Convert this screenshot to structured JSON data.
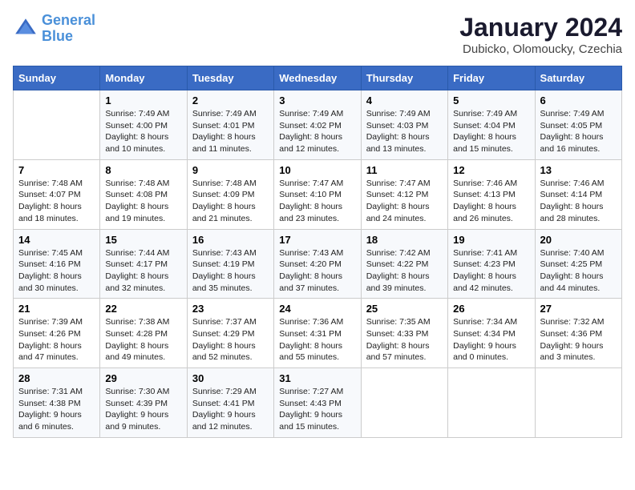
{
  "logo": {
    "line1": "General",
    "line2": "Blue"
  },
  "title": "January 2024",
  "subtitle": "Dubicko, Olomoucky, Czechia",
  "days_header": [
    "Sunday",
    "Monday",
    "Tuesday",
    "Wednesday",
    "Thursday",
    "Friday",
    "Saturday"
  ],
  "weeks": [
    [
      {
        "num": "",
        "info": ""
      },
      {
        "num": "1",
        "info": "Sunrise: 7:49 AM\nSunset: 4:00 PM\nDaylight: 8 hours\nand 10 minutes."
      },
      {
        "num": "2",
        "info": "Sunrise: 7:49 AM\nSunset: 4:01 PM\nDaylight: 8 hours\nand 11 minutes."
      },
      {
        "num": "3",
        "info": "Sunrise: 7:49 AM\nSunset: 4:02 PM\nDaylight: 8 hours\nand 12 minutes."
      },
      {
        "num": "4",
        "info": "Sunrise: 7:49 AM\nSunset: 4:03 PM\nDaylight: 8 hours\nand 13 minutes."
      },
      {
        "num": "5",
        "info": "Sunrise: 7:49 AM\nSunset: 4:04 PM\nDaylight: 8 hours\nand 15 minutes."
      },
      {
        "num": "6",
        "info": "Sunrise: 7:49 AM\nSunset: 4:05 PM\nDaylight: 8 hours\nand 16 minutes."
      }
    ],
    [
      {
        "num": "7",
        "info": "Sunrise: 7:48 AM\nSunset: 4:07 PM\nDaylight: 8 hours\nand 18 minutes."
      },
      {
        "num": "8",
        "info": "Sunrise: 7:48 AM\nSunset: 4:08 PM\nDaylight: 8 hours\nand 19 minutes."
      },
      {
        "num": "9",
        "info": "Sunrise: 7:48 AM\nSunset: 4:09 PM\nDaylight: 8 hours\nand 21 minutes."
      },
      {
        "num": "10",
        "info": "Sunrise: 7:47 AM\nSunset: 4:10 PM\nDaylight: 8 hours\nand 23 minutes."
      },
      {
        "num": "11",
        "info": "Sunrise: 7:47 AM\nSunset: 4:12 PM\nDaylight: 8 hours\nand 24 minutes."
      },
      {
        "num": "12",
        "info": "Sunrise: 7:46 AM\nSunset: 4:13 PM\nDaylight: 8 hours\nand 26 minutes."
      },
      {
        "num": "13",
        "info": "Sunrise: 7:46 AM\nSunset: 4:14 PM\nDaylight: 8 hours\nand 28 minutes."
      }
    ],
    [
      {
        "num": "14",
        "info": "Sunrise: 7:45 AM\nSunset: 4:16 PM\nDaylight: 8 hours\nand 30 minutes."
      },
      {
        "num": "15",
        "info": "Sunrise: 7:44 AM\nSunset: 4:17 PM\nDaylight: 8 hours\nand 32 minutes."
      },
      {
        "num": "16",
        "info": "Sunrise: 7:43 AM\nSunset: 4:19 PM\nDaylight: 8 hours\nand 35 minutes."
      },
      {
        "num": "17",
        "info": "Sunrise: 7:43 AM\nSunset: 4:20 PM\nDaylight: 8 hours\nand 37 minutes."
      },
      {
        "num": "18",
        "info": "Sunrise: 7:42 AM\nSunset: 4:22 PM\nDaylight: 8 hours\nand 39 minutes."
      },
      {
        "num": "19",
        "info": "Sunrise: 7:41 AM\nSunset: 4:23 PM\nDaylight: 8 hours\nand 42 minutes."
      },
      {
        "num": "20",
        "info": "Sunrise: 7:40 AM\nSunset: 4:25 PM\nDaylight: 8 hours\nand 44 minutes."
      }
    ],
    [
      {
        "num": "21",
        "info": "Sunrise: 7:39 AM\nSunset: 4:26 PM\nDaylight: 8 hours\nand 47 minutes."
      },
      {
        "num": "22",
        "info": "Sunrise: 7:38 AM\nSunset: 4:28 PM\nDaylight: 8 hours\nand 49 minutes."
      },
      {
        "num": "23",
        "info": "Sunrise: 7:37 AM\nSunset: 4:29 PM\nDaylight: 8 hours\nand 52 minutes."
      },
      {
        "num": "24",
        "info": "Sunrise: 7:36 AM\nSunset: 4:31 PM\nDaylight: 8 hours\nand 55 minutes."
      },
      {
        "num": "25",
        "info": "Sunrise: 7:35 AM\nSunset: 4:33 PM\nDaylight: 8 hours\nand 57 minutes."
      },
      {
        "num": "26",
        "info": "Sunrise: 7:34 AM\nSunset: 4:34 PM\nDaylight: 9 hours\nand 0 minutes."
      },
      {
        "num": "27",
        "info": "Sunrise: 7:32 AM\nSunset: 4:36 PM\nDaylight: 9 hours\nand 3 minutes."
      }
    ],
    [
      {
        "num": "28",
        "info": "Sunrise: 7:31 AM\nSunset: 4:38 PM\nDaylight: 9 hours\nand 6 minutes."
      },
      {
        "num": "29",
        "info": "Sunrise: 7:30 AM\nSunset: 4:39 PM\nDaylight: 9 hours\nand 9 minutes."
      },
      {
        "num": "30",
        "info": "Sunrise: 7:29 AM\nSunset: 4:41 PM\nDaylight: 9 hours\nand 12 minutes."
      },
      {
        "num": "31",
        "info": "Sunrise: 7:27 AM\nSunset: 4:43 PM\nDaylight: 9 hours\nand 15 minutes."
      },
      {
        "num": "",
        "info": ""
      },
      {
        "num": "",
        "info": ""
      },
      {
        "num": "",
        "info": ""
      }
    ]
  ]
}
